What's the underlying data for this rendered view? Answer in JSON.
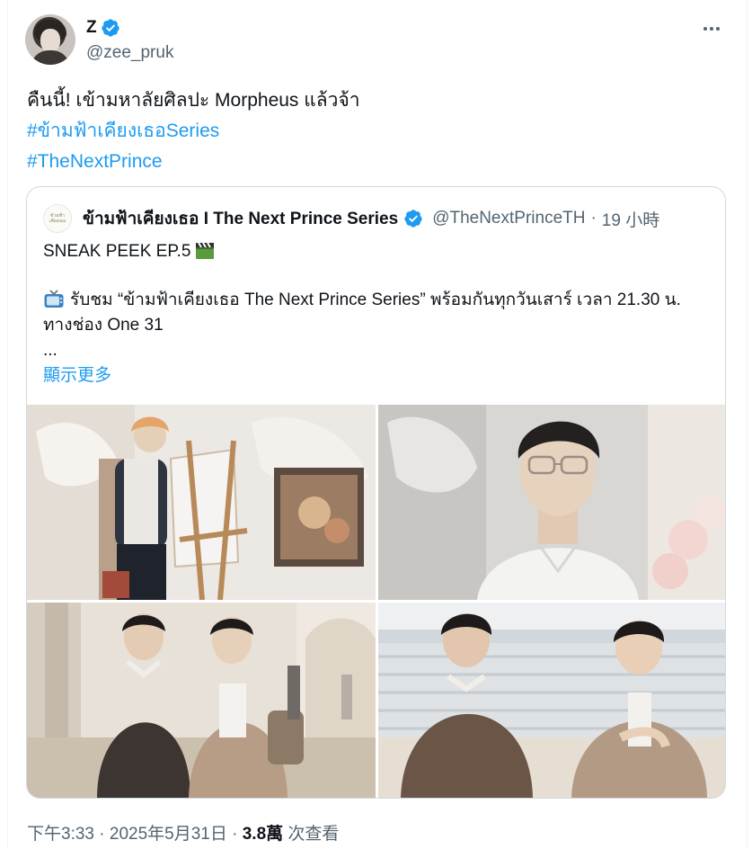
{
  "tweet": {
    "author": {
      "display_name": "Z",
      "handle": "@zee_pruk",
      "verified_icon": "verified-badge-icon"
    },
    "text": {
      "line1": "คืนนี้! เข้ามหาลัยศิลปะ Morpheus แล้วจ้า",
      "hashtag1": "#ข้ามฟ้าเคียงเธอSeries",
      "hashtag2": "#TheNextPrince"
    },
    "more_icon": "more-options-icon",
    "footer": {
      "time": "下午3:33",
      "sep1": " · ",
      "date": "2025年5月31日",
      "sep2": " · ",
      "views": "3.8萬",
      "views_label": " 次查看"
    }
  },
  "quote": {
    "author": {
      "display_name": "ข้ามฟ้าเคียงเธอ I The Next Prince Series",
      "handle": "@TheNextPrinceTH",
      "dot": "·",
      "time": "19 小時"
    },
    "text": {
      "line1": "SNEAK PEEK EP.5",
      "line2": "รับชม “ข้ามฟ้าเคียงเธอ The Next Prince Series” พร้อมกันทุกวันเสาร์ เวลา 21.30 น.",
      "line3": "ทางช่อง One 31",
      "ellipsis": "...",
      "show_more": "顯示更多"
    },
    "media": [
      {
        "name": "photo-painting-at-easel"
      },
      {
        "name": "photo-man-with-glasses"
      },
      {
        "name": "photo-two-walking-hallway"
      },
      {
        "name": "photo-two-on-steps"
      }
    ]
  },
  "colors": {
    "link": "#1d9bf0",
    "text": "#0f1419",
    "secondary": "#536471",
    "border": "#cfd9de"
  }
}
